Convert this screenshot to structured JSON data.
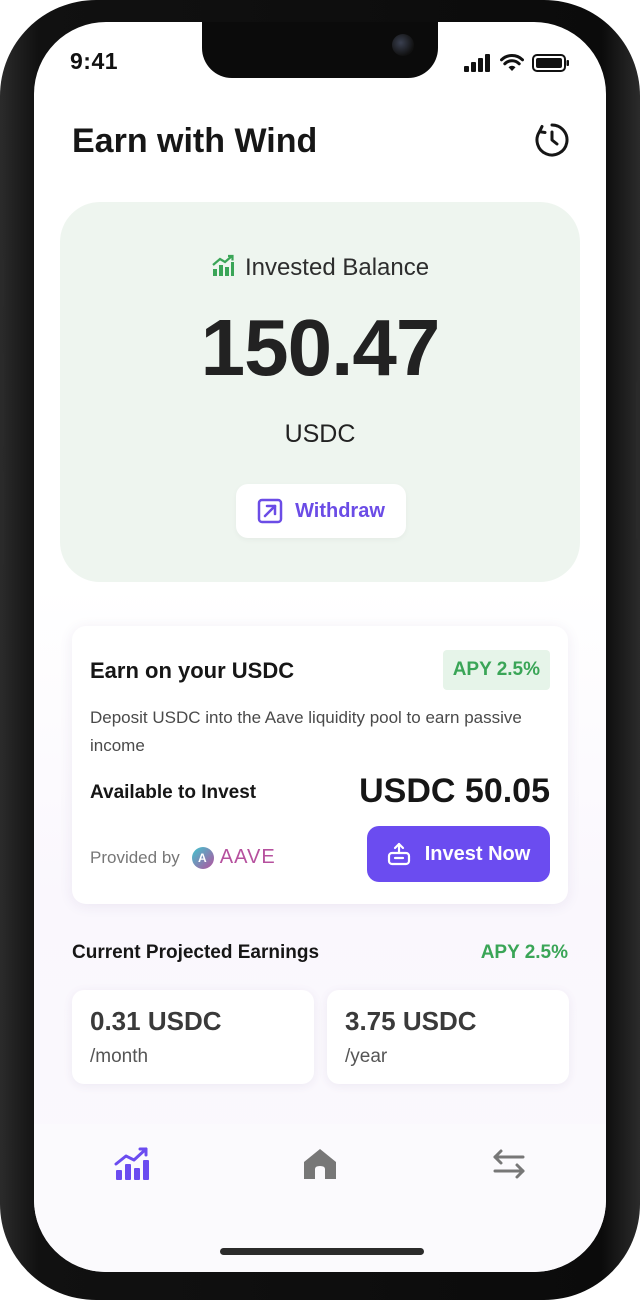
{
  "status_bar": {
    "time": "9:41"
  },
  "header": {
    "title": "Earn with Wind",
    "history_icon": "history-clock-icon"
  },
  "balance": {
    "label": "Invested Balance",
    "amount": "150.47",
    "unit": "USDC",
    "withdraw_label": "Withdraw"
  },
  "earn": {
    "title": "Earn on your USDC",
    "apy": "APY 2.5%",
    "description": "Deposit USDC into the Aave liquidity pool to earn passive income",
    "available_label": "Available to Invest",
    "available_amount": "USDC 50.05",
    "provided_by": "Provided by",
    "provider": "AAVE",
    "invest_label": "Invest Now"
  },
  "projected": {
    "title": "Current Projected Earnings",
    "apy": "APY 2.5%",
    "monthly_value": "0.31 USDC",
    "monthly_period": "/month",
    "yearly_value": "3.75 USDC",
    "yearly_period": "/year"
  },
  "nav": {
    "items": [
      "earn-chart-icon",
      "home-icon",
      "transfer-arrows-icon"
    ]
  },
  "colors": {
    "accent": "#6b4cf0",
    "green": "#3aa557",
    "card_green": "#eef5ef"
  }
}
